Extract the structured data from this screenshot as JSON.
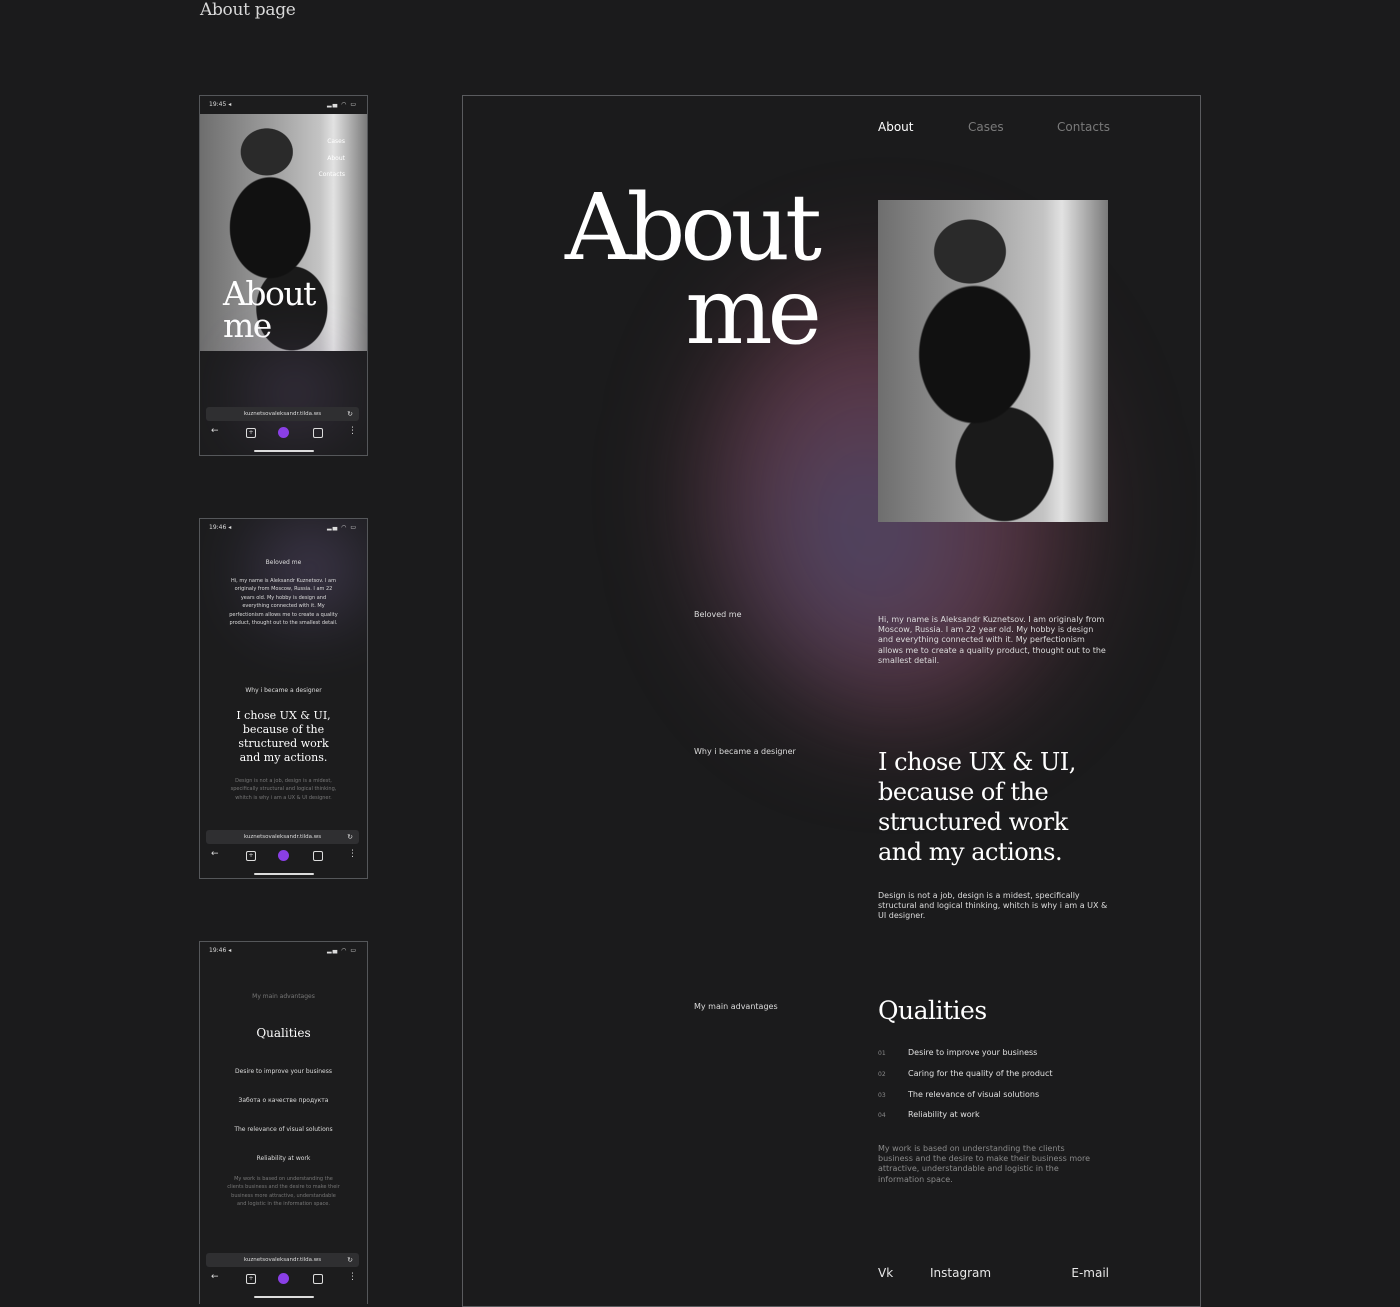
{
  "page_title": "About page",
  "phone1": {
    "time": "19:45 ◂",
    "menu": [
      "Cases",
      "About",
      "Contacts"
    ],
    "heading_line1": "About",
    "heading_line2": "me",
    "url": "kuznetsovaleksandr.tilda.ws"
  },
  "phone2": {
    "time": "19:46 ◂",
    "beloved_label": "Beloved me",
    "bio": "Hi, my name is Aleksandr Kuznetsov. I am originaly from Moscow, Russia. I am 22 years old. My hobby is design and everything connected with it. My perfectionism allows me to create a quality product, thought out to the smallest detail.",
    "why_label": "Why i became a designer",
    "quote": "I chose UX & UI, because of the structured work and my actions.",
    "design_note": "Design is not a job, design is a midest, specifically structural and logical thinking, whitch is why i am a UX & UI designer.",
    "url": "kuznetsovaleksandr.tilda.ws"
  },
  "phone3": {
    "time": "19:46 ◂",
    "advantages_label": "My main advantages",
    "qualities_title": "Qualities",
    "qualities": [
      "Desire to improve your business",
      "Забота о качестве продукта",
      "The relevance of visual solutions",
      "Reliability at work"
    ],
    "footer_text": "My work is based on understanding the clients business and the desire to make their business more attractive, understandable and logistic in the information space.",
    "url": "kuznetsovaleksandr.tilda.ws"
  },
  "desktop": {
    "nav": [
      {
        "label": "About",
        "active": true
      },
      {
        "label": "Cases",
        "active": false
      },
      {
        "label": "Contacts",
        "active": false
      }
    ],
    "heading_line1": "About",
    "heading_line2": "me",
    "beloved_label": "Beloved me",
    "bio": "Hi, my name is Aleksandr Kuznetsov. I am originaly from Moscow, Russia. I am 22 year old. My hobby is design and everything connected with it. My perfectionism allows me to create a quality product, thought out to the smallest detail.",
    "why_label": "Why i became a designer",
    "quote_lines": [
      "I chose UX & UI,",
      "because of the",
      "structured work",
      "and my actions."
    ],
    "design_note": "Design is not a job, design is a midest, specifically structural and logical thinking, whitch is why i am a UX & UI designer.",
    "advantages_label": "My main advantages",
    "qualities_title": "Qualities",
    "qualities": [
      {
        "num": "01",
        "label": "Desire to improve your business"
      },
      {
        "num": "02",
        "label": "Caring for the quality of the product"
      },
      {
        "num": "03",
        "label": "The relevance of visual solutions"
      },
      {
        "num": "04",
        "label": "Reliability at work"
      }
    ],
    "footer_text": "My work is based on understanding the clients business and the desire to make their business more attractive, understandable and logistic in the information space.",
    "social": [
      "Vk",
      "Instagram",
      "E-mail"
    ]
  },
  "colors": {
    "background": "#1b1b1c",
    "accent_purple": "#8a3fe6",
    "glow_pink": "#b45a78",
    "glow_blue": "#6a6fb0"
  }
}
